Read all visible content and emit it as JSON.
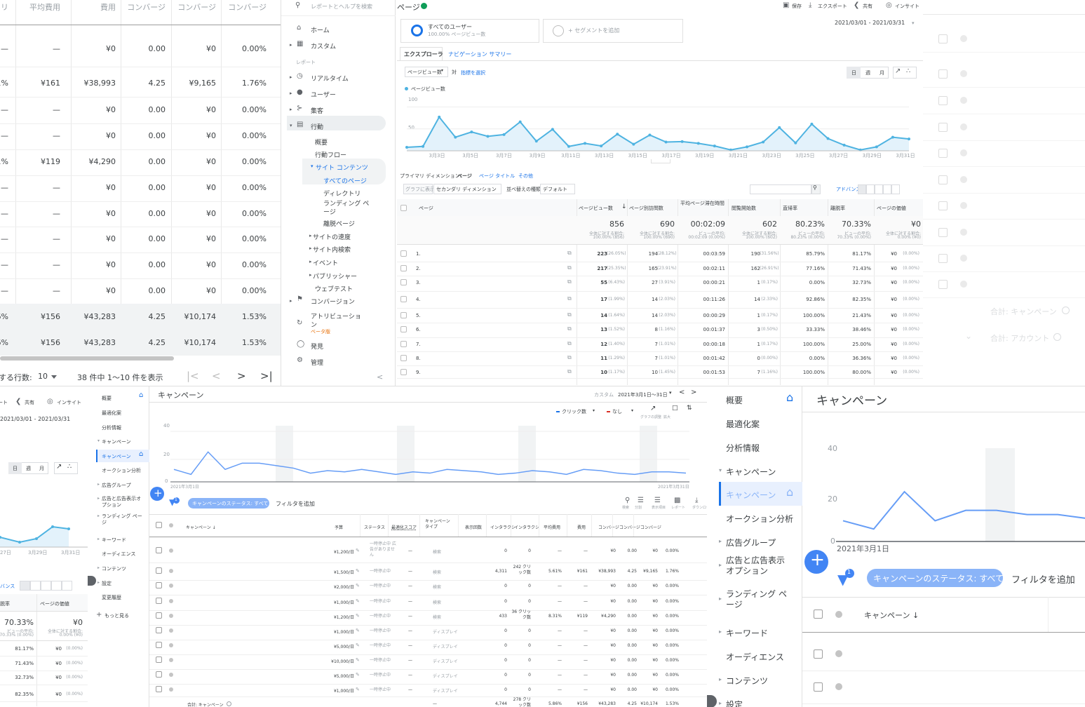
{
  "ads_table": {
    "headers": [
      "クリ",
      "平均費用",
      "費用",
      "コンバージ",
      "コンバージ",
      "コンバージ"
    ],
    "rows": [
      [
        "—",
        "—",
        "¥0",
        "0.00",
        "¥0",
        "0.00%"
      ],
      [
        "1%",
        "¥161",
        "¥38,993",
        "4.25",
        "¥9,165",
        "1.76%"
      ],
      [
        "—",
        "—",
        "¥0",
        "0.00",
        "¥0",
        "0.00%"
      ],
      [
        "—",
        "—",
        "¥0",
        "0.00",
        "¥0",
        "0.00%"
      ],
      [
        "1%",
        "¥119",
        "¥4,290",
        "0.00",
        "¥0",
        "0.00%"
      ],
      [
        "—",
        "—",
        "¥0",
        "0.00",
        "¥0",
        "0.00%"
      ],
      [
        "—",
        "—",
        "¥0",
        "0.00",
        "¥0",
        "0.00%"
      ],
      [
        "—",
        "—",
        "¥0",
        "0.00",
        "¥0",
        "0.00%"
      ],
      [
        "—",
        "—",
        "¥0",
        "0.00",
        "¥0",
        "0.00%"
      ],
      [
        "—",
        "—",
        "¥0",
        "0.00",
        "¥0",
        "0.00%"
      ],
      [
        "6%",
        "¥156",
        "¥43,283",
        "4.25",
        "¥10,174",
        "1.53%"
      ],
      [
        "6%",
        "¥156",
        "¥43,283",
        "4.25",
        "¥10,174",
        "1.53%"
      ]
    ],
    "pager_label": "する行数:",
    "pager_rows": "10",
    "pager_range": "38 件中 1～10 件を表示"
  },
  "ga": {
    "search_placeholder": "レポートとヘルプを検索",
    "nav": {
      "home": "ホーム",
      "custom": "カスタム",
      "reports_header": "レポート",
      "realtime": "リアルタイム",
      "users": "ユーザー",
      "acquisition": "集客",
      "behavior": "行動",
      "overview": "概要",
      "behavior_flow": "行動フロー",
      "site_content": "サイト コンテンツ",
      "all_pages": "すべてのページ",
      "directory": "ディレクトリ",
      "landing_pages": "ランディング ページ",
      "exit_pages": "離脱ページ",
      "site_speed": "サイトの速度",
      "site_search": "サイト内検索",
      "events": "イベント",
      "publisher": "パブリッシャー",
      "experiments": "ウェブテスト",
      "conversions": "コンバージョン",
      "attribution": "アトリビューション",
      "beta": "ベータ版",
      "discover": "発見",
      "admin": "管理"
    },
    "title": "ページ",
    "actions": [
      "保存",
      "エクスポート",
      "共有",
      "インサイト"
    ],
    "date_range": "2021/03/01 - 2021/03/31",
    "segment_name": "すべてのユーザー",
    "segment_sub": "100.00% ページビュー数",
    "add_segment": "+ セグメントを追加",
    "tabs": [
      "エクスプローラ",
      "ナビゲーション サマリー"
    ],
    "metric_select": "ページビュー数",
    "vs": "対",
    "select_metric": "指標を選択",
    "granularity": [
      "日",
      "週",
      "月"
    ],
    "legend": "ページビュー数",
    "y_ticks": [
      "100",
      "50"
    ],
    "x_ticks": [
      "3月3日",
      "3月5日",
      "3月7日",
      "3月9日",
      "3月11日",
      "3月13日",
      "3月15日",
      "3月17日",
      "3月19日",
      "3月21日",
      "3月23日",
      "3月25日",
      "3月27日",
      "3月29日",
      "3月31日"
    ],
    "primary_dim_label": "プライマリ ディメンション:",
    "primary_dims": [
      "ページ",
      "ページ タイトル",
      "その他"
    ],
    "plot_rows": "グラフに表示",
    "secondary_dim": "セカンダリ ディメンション",
    "sort_type_label": "並べ替えの種類:",
    "sort_type": "デフォルト",
    "advanced": "アドバンス",
    "table_headers": [
      "ページ",
      "ページビュー数",
      "ページ別訪問数",
      "平均ページ滞在時間",
      "閲覧開始数",
      "直帰率",
      "離脱率",
      "ページの価値"
    ],
    "totals": [
      {
        "v": "856",
        "s1": "全体に対する割合:",
        "s2": "100.00% (856)"
      },
      {
        "v": "690",
        "s1": "全体に対する割合:",
        "s2": "100.00% (690)"
      },
      {
        "v": "00:02:09",
        "s1": "ビューの平均:",
        "s2": "00:02:09 (0.00%)"
      },
      {
        "v": "602",
        "s1": "全体に対する割合:",
        "s2": "100.00% (602)"
      },
      {
        "v": "80.23%",
        "s1": "ビューの平均:",
        "s2": "80.23% (0.00%)"
      },
      {
        "v": "70.33%",
        "s1": "ビューの平均:",
        "s2": "70.33% (0.00%)"
      },
      {
        "v": "¥0",
        "s1": "全体に対する割合:",
        "s2": "0.00% (¥0)"
      }
    ],
    "rows": [
      [
        "1.",
        "223",
        "(26.05%)",
        "194",
        "(28.12%)",
        "00:03:59",
        "190",
        "(31.56%)",
        "85.79%",
        "81.17%",
        "¥0",
        "(0.00%)"
      ],
      [
        "2.",
        "217",
        "(25.35%)",
        "165",
        "(23.91%)",
        "00:02:11",
        "162",
        "(26.91%)",
        "77.16%",
        "71.43%",
        "¥0",
        "(0.00%)"
      ],
      [
        "3.",
        "55",
        "(6.43%)",
        "27",
        "(3.91%)",
        "00:00:21",
        "1",
        "(0.17%)",
        "0.00%",
        "32.73%",
        "¥0",
        "(0.00%)"
      ],
      [
        "4.",
        "17",
        "(1.99%)",
        "14",
        "(2.03%)",
        "00:11:26",
        "14",
        "(2.33%)",
        "92.86%",
        "82.35%",
        "¥0",
        "(0.00%)"
      ],
      [
        "5.",
        "14",
        "(1.64%)",
        "14",
        "(2.03%)",
        "00:00:29",
        "1",
        "(0.17%)",
        "100.00%",
        "21.43%",
        "¥0",
        "(0.00%)"
      ],
      [
        "6.",
        "13",
        "(1.52%)",
        "8",
        "(1.16%)",
        "00:01:37",
        "3",
        "(0.50%)",
        "33.33%",
        "38.46%",
        "¥0",
        "(0.00%)"
      ],
      [
        "7.",
        "12",
        "(1.40%)",
        "7",
        "(1.01%)",
        "00:00:18",
        "1",
        "(0.17%)",
        "100.00%",
        "25.00%",
        "¥0",
        "(0.00%)"
      ],
      [
        "8.",
        "11",
        "(1.29%)",
        "7",
        "(1.01%)",
        "00:01:42",
        "0",
        "(0.00%)",
        "0.00%",
        "36.36%",
        "¥0",
        "(0.00%)"
      ],
      [
        "9.",
        "10",
        "(1.17%)",
        "10",
        "(1.45%)",
        "00:01:53",
        "7",
        "(1.16%)",
        "100.00%",
        "80.00%",
        "¥0",
        "(0.00%)"
      ]
    ]
  },
  "right_ads": {
    "total_campaign": "合計: キャンペーン",
    "total_account": "合計: アカウント"
  },
  "ga_fragment": {
    "actions": [
      "ート",
      "共有",
      "インサイト"
    ],
    "date_range": "2021/03/01 - 2021/03/31",
    "granularity": [
      "日",
      "週",
      "月"
    ],
    "x_ticks": [
      "27日",
      "3月29日",
      "3月31日"
    ],
    "advanced": "バンス",
    "headers": [
      "脱率",
      "ページの価値"
    ],
    "total_rate": "70.33%",
    "total_rate_s1": "ビューの平均:",
    "total_rate_s2": "70.33% (0.00%)",
    "total_value": "¥0",
    "total_value_s1": "全体に対する割合:",
    "total_value_s2": "0.00% (¥0)",
    "rows": [
      [
        "81.17%",
        "¥0",
        "(0.00%)"
      ],
      [
        "71.43%",
        "¥0",
        "(0.00%)"
      ],
      [
        "32.73%",
        "¥0",
        "(0.00%)"
      ],
      [
        "82.35%",
        "¥0",
        "(0.00%)"
      ]
    ]
  },
  "ads_mid": {
    "sidebar": [
      "概要",
      "最適化案",
      "分析情報",
      "キャンペーン",
      "キャンペーン",
      "オークション分析",
      "広告グループ",
      "広告と広告表示オプション",
      "ランディング ページ",
      "キーワード",
      "オーディエンス",
      "コンテンツ",
      "設定",
      "変更履歴",
      "もっと見る"
    ],
    "title": "キャンペーン",
    "date_label": "カスタム",
    "date_value": "2021年3月1日～31日",
    "metric1": "クリック数",
    "metric2": "なし",
    "chart_tools": [
      "グラフの調整",
      "拡大",
      "調整"
    ],
    "y_ticks": [
      "40",
      "20",
      "0"
    ],
    "x_start": "2021年3月1日",
    "x_end": "2021年3月31日",
    "filter_badge": "1",
    "status_chip": "キャンペーンのステータス: すべて",
    "add_filter": "フィルタを追加",
    "toolbar": [
      "検索",
      "分割",
      "表示項目",
      "レポート",
      "ダウンロード",
      "拡大",
      "その他"
    ],
    "headers": [
      "キャンペーン ↓",
      "予算",
      "ステータス",
      "最適化スコア",
      "キャンペーン タイプ",
      "表示回数",
      "インタラクシ",
      "インタラクシ",
      "平均費用",
      "費用",
      "コンバージ",
      "コンバージ",
      "コンバージ"
    ],
    "rows": [
      [
        "¥1,200/日",
        "一時停止中 広告がありません",
        "—",
        "検索",
        "0",
        "0",
        "—",
        "—",
        "¥0",
        "0.00",
        "¥0",
        "0.00%"
      ],
      [
        "¥1,500/日",
        "一時停止中",
        "—",
        "検索",
        "4,311",
        "242 クリック数",
        "5.61%",
        "¥161",
        "¥38,993",
        "4.25",
        "¥9,165",
        "1.76%"
      ],
      [
        "¥2,000/日",
        "一時停止中",
        "—",
        "検索",
        "0",
        "0",
        "—",
        "—",
        "¥0",
        "0.00",
        "¥0",
        "0.00%"
      ],
      [
        "¥1,000/日",
        "一時停止中",
        "—",
        "検索",
        "0",
        "0",
        "—",
        "—",
        "¥0",
        "0.00",
        "¥0",
        "0.00%"
      ],
      [
        "¥1,200/日",
        "一時停止中",
        "—",
        "検索",
        "433",
        "36 クリック数",
        "8.31%",
        "¥119",
        "¥4,290",
        "0.00",
        "¥0",
        "0.00%"
      ],
      [
        "¥1,000/日",
        "一時停止中",
        "—",
        "ディスプレイ",
        "0",
        "0",
        "—",
        "—",
        "¥0",
        "0.00",
        "¥0",
        "0.00%"
      ],
      [
        "¥5,000/日",
        "一時停止中",
        "—",
        "ディスプレイ",
        "0",
        "0",
        "—",
        "—",
        "¥0",
        "0.00",
        "¥0",
        "0.00%"
      ],
      [
        "¥10,000/日",
        "一時停止中",
        "—",
        "ディスプレイ",
        "0",
        "0",
        "—",
        "—",
        "¥0",
        "0.00",
        "¥0",
        "0.00%"
      ],
      [
        "¥5,000/日",
        "一時停止中",
        "—",
        "ディスプレイ",
        "0",
        "0",
        "—",
        "—",
        "¥0",
        "0.00",
        "¥0",
        "0.00%"
      ],
      [
        "¥1,000/日",
        "一時停止中",
        "—",
        "ディスプレイ",
        "0",
        "0",
        "—",
        "—",
        "¥0",
        "0.00",
        "¥0",
        "0.00%"
      ]
    ],
    "total_label": "合計: キャンペーン",
    "total": [
      "—",
      "4,744",
      "278 クリック数",
      "5.86%",
      "¥156",
      "¥43,283",
      "4.25",
      "¥10,174",
      "1.53%"
    ]
  },
  "ads_big": {
    "sidebar": [
      "概要",
      "最適化案",
      "分析情報",
      "キャンペーン",
      "キャンペーン",
      "オークション分析",
      "広告グループ",
      "広告と広告表示オプション",
      "ランディング ページ",
      "キーワード",
      "オーディエンス",
      "コンテンツ",
      "設定"
    ],
    "title": "キャンペーン",
    "y_ticks": [
      "40",
      "20",
      "0"
    ],
    "x_start": "2021年3月1日",
    "filter_badge": "1",
    "status_chip": "キャンペーンのステータス: すべて",
    "add_filter": "フィルタを追加",
    "header_campaign": "キャンペーン ↓"
  },
  "chart_data": [
    {
      "type": "line",
      "title": "",
      "series": [
        {
          "name": "ページビュー数",
          "values": [
            8,
            10,
            77,
            31,
            43,
            33,
            37,
            66,
            22,
            49,
            10,
            17,
            11,
            38,
            15,
            36,
            20,
            21,
            17,
            11,
            2,
            9,
            20,
            53,
            18,
            61,
            28,
            13,
            2,
            9,
            31,
            27
          ]
        }
      ],
      "x_ticks": [
        "3月3日",
        "3月5日",
        "3月7日",
        "3月9日",
        "3月11日",
        "3月13日",
        "3月15日",
        "3月17日",
        "3月19日",
        "3月21日",
        "3月23日",
        "3月25日",
        "3月27日",
        "3月29日",
        "3月31日"
      ],
      "y_ticks": [
        "100",
        "50"
      ],
      "ylim": [
        0,
        120
      ]
    },
    {
      "type": "line",
      "title": "",
      "series": [
        {
          "name": "クリック数",
          "values": [
            10,
            6,
            24,
            10,
            15,
            15,
            13,
            11,
            7,
            9,
            8,
            10,
            8,
            6,
            8,
            7,
            10,
            9,
            8,
            6,
            7,
            9,
            8,
            6,
            10,
            9,
            7,
            6,
            8,
            8,
            7
          ]
        }
      ],
      "y_ticks": [
        "40",
        "20",
        "0"
      ],
      "x_start": "2021年3月1日",
      "x_end": "2021年3月31日",
      "ylim": [
        0,
        45
      ]
    },
    {
      "type": "line",
      "title": "",
      "series": [
        {
          "name": "クリック数",
          "values": [
            10,
            6,
            24,
            10,
            15,
            15,
            13,
            13,
            11
          ]
        }
      ],
      "y_ticks": [
        "40",
        "20",
        "0"
      ],
      "x_start": "2021年3月1日",
      "ylim": [
        0,
        45
      ]
    }
  ]
}
